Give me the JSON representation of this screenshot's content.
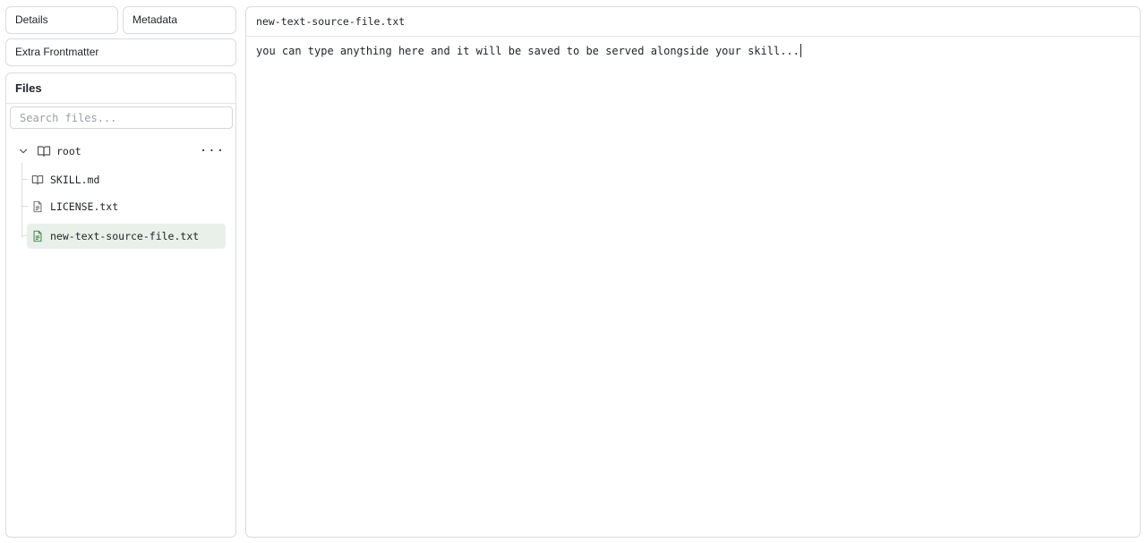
{
  "tabs": {
    "details": "Details",
    "metadata": "Metadata",
    "extra_frontmatter": "Extra Frontmatter"
  },
  "files": {
    "title": "Files",
    "search_placeholder": "Search files...",
    "root_label": "root",
    "more_label": "···",
    "items": [
      {
        "name": "SKILL.md",
        "icon": "book-icon"
      },
      {
        "name": "LICENSE.txt",
        "icon": "file-text-icon"
      },
      {
        "name": "new-text-source-file.txt",
        "icon": "file-text-icon",
        "selected": true
      }
    ]
  },
  "editor": {
    "filename": "new-text-source-file.txt",
    "content": "you can type anything here and it will be saved to be served alongside your skill..."
  },
  "colors": {
    "border": "#d9dcdf",
    "selected_bg": "#e9efe9",
    "file_icon_green": "#3a7d44"
  }
}
